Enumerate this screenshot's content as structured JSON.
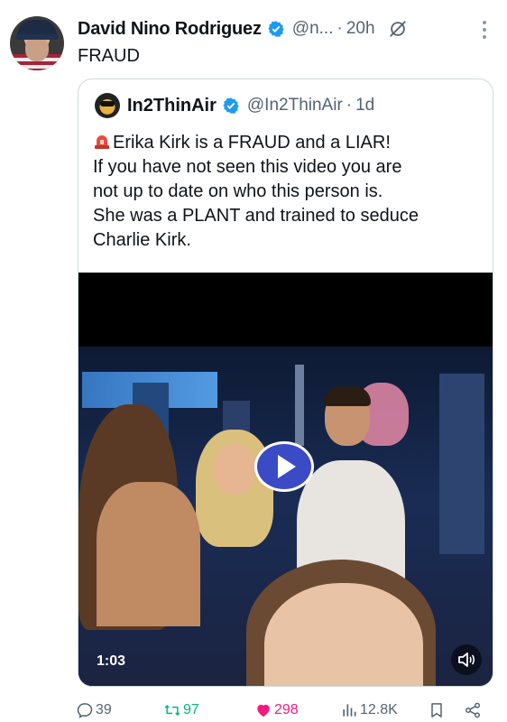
{
  "post": {
    "author_name": "David Nino Rodriguez",
    "handle": "@n...",
    "separator": "·",
    "time": "20h",
    "text": "FRAUD"
  },
  "quote": {
    "author_name": "In2ThinAir",
    "handle": "@In2ThinAir",
    "separator": "·",
    "time": "1d",
    "lines": [
      "Erika Kirk is a FRAUD and a LIAR!",
      "If you have not seen this video you are",
      "not up to date on who this person is.",
      "She was a PLANT and trained to seduce",
      "Charlie Kirk."
    ],
    "video": {
      "duration": "1:03"
    }
  },
  "actions": {
    "replies": "39",
    "reposts": "97",
    "likes": "298",
    "views": "12.8K"
  },
  "colors": {
    "verified": "#1d9bf0",
    "repost": "#00ba7c",
    "like": "#f91880",
    "muted_text": "#536471",
    "play_button": "#3b4bc6"
  },
  "icons": [
    "verified-badge-icon",
    "grok-icon",
    "more-icon",
    "siren-icon",
    "play-icon",
    "mute-icon",
    "reply-icon",
    "repost-icon",
    "like-icon",
    "views-icon",
    "bookmark-icon",
    "share-icon"
  ]
}
